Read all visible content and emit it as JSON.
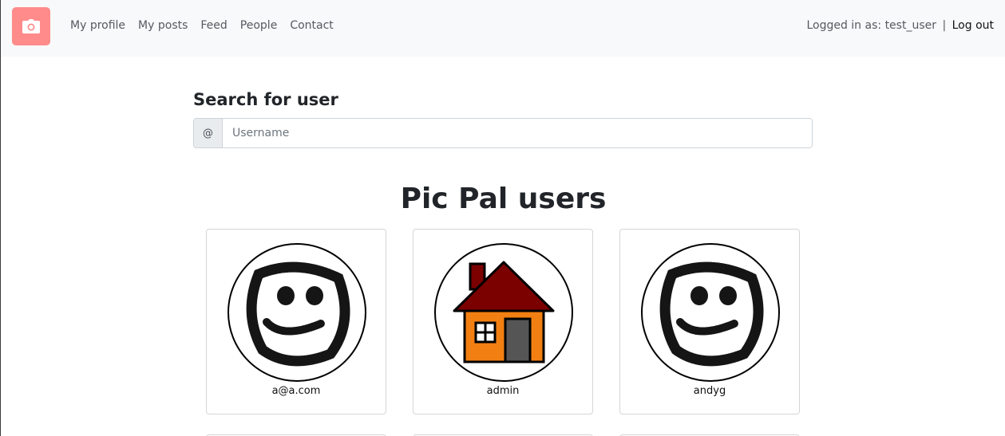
{
  "nav": {
    "brand_icon": "camera-icon",
    "brand_color": "#ff8b8b",
    "links": [
      "My profile",
      "My posts",
      "Feed",
      "People",
      "Contact"
    ],
    "logged_in_prefix": "Logged in as:",
    "username": "test_user",
    "separator": "|",
    "logout": "Log out"
  },
  "search": {
    "title": "Search for user",
    "prefix": "@",
    "placeholder": "Username",
    "value": ""
  },
  "users": {
    "title": "Pic Pal users",
    "cards": [
      {
        "name": "a@a.com",
        "avatar": "smiley-icon"
      },
      {
        "name": "admin",
        "avatar": "house-icon"
      },
      {
        "name": "andyg",
        "avatar": "smiley-icon"
      }
    ]
  }
}
